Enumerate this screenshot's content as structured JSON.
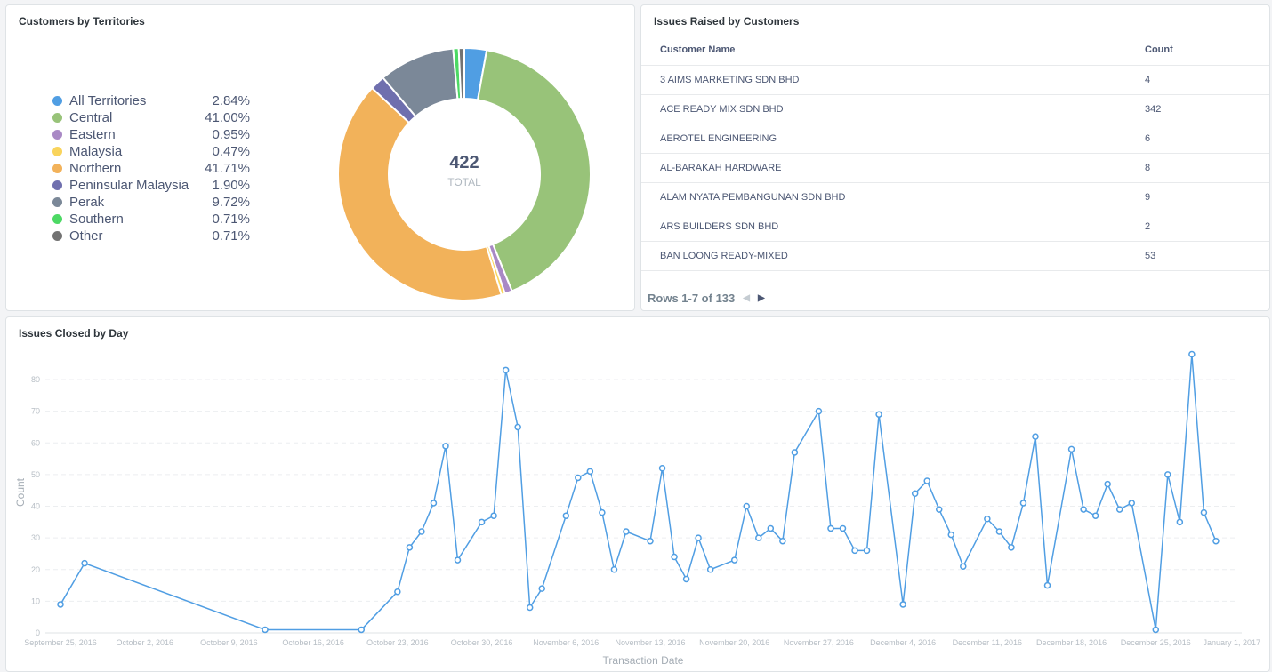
{
  "pie_card": {
    "title": "Customers by Territories",
    "total_value": "422",
    "total_label": "TOTAL",
    "legend": [
      {
        "label": "All Territories",
        "value": "2.84%",
        "color": "#509ee3"
      },
      {
        "label": "Central",
        "value": "41.00%",
        "color": "#98c379"
      },
      {
        "label": "Eastern",
        "value": "0.95%",
        "color": "#a989c5"
      },
      {
        "label": "Malaysia",
        "value": "0.47%",
        "color": "#f9d45c"
      },
      {
        "label": "Northern",
        "value": "41.71%",
        "color": "#f2b25a"
      },
      {
        "label": "Peninsular Malaysia",
        "value": "1.90%",
        "color": "#6f6fae"
      },
      {
        "label": "Perak",
        "value": "9.72%",
        "color": "#7b8898"
      },
      {
        "label": "Southern",
        "value": "0.71%",
        "color": "#4cd964"
      },
      {
        "label": "Other",
        "value": "0.71%",
        "color": "#727272"
      }
    ]
  },
  "table_card": {
    "title": "Issues Raised by Customers",
    "headers": [
      "Customer Name",
      "Count"
    ],
    "rows": [
      [
        "3 AIMS MARKETING SDN BHD",
        "4"
      ],
      [
        "ACE READY MIX SDN BHD",
        "342"
      ],
      [
        "AEROTEL ENGINEERING",
        "6"
      ],
      [
        "AL-BARAKAH HARDWARE",
        "8"
      ],
      [
        "ALAM NYATA PEMBANGUNAN SDN BHD",
        "9"
      ],
      [
        "ARS BUILDERS SDN BHD",
        "2"
      ],
      [
        "BAN LOONG READY-MIXED",
        "53"
      ]
    ],
    "pager_text": "Rows 1-7 of 133",
    "prev_icon": "chevron-left-icon",
    "next_icon": "chevron-right-icon"
  },
  "line_card": {
    "title": "Issues Closed by Day"
  },
  "chart_data": [
    {
      "type": "pie",
      "title": "Customers by Territories",
      "categories": [
        "All Territories",
        "Central",
        "Eastern",
        "Malaysia",
        "Northern",
        "Peninsular Malaysia",
        "Perak",
        "Southern",
        "Other"
      ],
      "values": [
        2.84,
        41.0,
        0.95,
        0.47,
        41.71,
        1.9,
        9.72,
        0.71,
        0.71
      ],
      "total": 422,
      "legend": "left"
    },
    {
      "type": "line",
      "title": "Issues Closed by Day",
      "xlabel": "Transaction Date",
      "ylabel": "Count",
      "ylim": [
        0,
        80
      ],
      "yticks": [
        0,
        10,
        20,
        30,
        40,
        50,
        60,
        70,
        80
      ],
      "xticks": [
        "September 25, 2016",
        "October 2, 2016",
        "October 9, 2016",
        "October 16, 2016",
        "October 23, 2016",
        "October 30, 2016",
        "November 6, 2016",
        "November 13, 2016",
        "November 20, 2016",
        "November 27, 2016",
        "December 4, 2016",
        "December 11, 2016",
        "December 18, 2016",
        "December 25, 2016",
        "January 1, 2017"
      ],
      "x_start": "2016-09-25",
      "x_end": "2017-01-01",
      "grid": true,
      "series": [
        {
          "color": "#509ee3",
          "points": [
            [
              "2016-09-25",
              9
            ],
            [
              "2016-09-27",
              22
            ],
            [
              "2016-10-12",
              1
            ],
            [
              "2016-10-20",
              1
            ],
            [
              "2016-10-23",
              13
            ],
            [
              "2016-10-24",
              27
            ],
            [
              "2016-10-25",
              32
            ],
            [
              "2016-10-26",
              41
            ],
            [
              "2016-10-27",
              59
            ],
            [
              "2016-10-28",
              23
            ],
            [
              "2016-10-30",
              35
            ],
            [
              "2016-10-31",
              37
            ],
            [
              "2016-11-01",
              83
            ],
            [
              "2016-11-02",
              65
            ],
            [
              "2016-11-03",
              8
            ],
            [
              "2016-11-04",
              14
            ],
            [
              "2016-11-06",
              37
            ],
            [
              "2016-11-07",
              49
            ],
            [
              "2016-11-08",
              51
            ],
            [
              "2016-11-09",
              38
            ],
            [
              "2016-11-10",
              20
            ],
            [
              "2016-11-11",
              32
            ],
            [
              "2016-11-13",
              29
            ],
            [
              "2016-11-14",
              52
            ],
            [
              "2016-11-15",
              24
            ],
            [
              "2016-11-16",
              17
            ],
            [
              "2016-11-17",
              30
            ],
            [
              "2016-11-18",
              20
            ],
            [
              "2016-11-20",
              23
            ],
            [
              "2016-11-21",
              40
            ],
            [
              "2016-11-22",
              30
            ],
            [
              "2016-11-23",
              33
            ],
            [
              "2016-11-24",
              29
            ],
            [
              "2016-11-25",
              57
            ],
            [
              "2016-11-27",
              70
            ],
            [
              "2016-11-28",
              33
            ],
            [
              "2016-11-29",
              33
            ],
            [
              "2016-11-30",
              26
            ],
            [
              "2016-12-01",
              26
            ],
            [
              "2016-12-02",
              69
            ],
            [
              "2016-12-04",
              9
            ],
            [
              "2016-12-05",
              44
            ],
            [
              "2016-12-06",
              48
            ],
            [
              "2016-12-07",
              39
            ],
            [
              "2016-12-08",
              31
            ],
            [
              "2016-12-09",
              21
            ],
            [
              "2016-12-11",
              36
            ],
            [
              "2016-12-12",
              32
            ],
            [
              "2016-12-13",
              27
            ],
            [
              "2016-12-14",
              41
            ],
            [
              "2016-12-15",
              62
            ],
            [
              "2016-12-16",
              15
            ],
            [
              "2016-12-18",
              58
            ],
            [
              "2016-12-19",
              39
            ],
            [
              "2016-12-20",
              37
            ],
            [
              "2016-12-21",
              47
            ],
            [
              "2016-12-22",
              39
            ],
            [
              "2016-12-23",
              41
            ],
            [
              "2016-12-25",
              1
            ],
            [
              "2016-12-26",
              50
            ],
            [
              "2016-12-27",
              35
            ],
            [
              "2016-12-28",
              88
            ],
            [
              "2016-12-29",
              38
            ],
            [
              "2016-12-30",
              29
            ]
          ]
        }
      ]
    }
  ]
}
